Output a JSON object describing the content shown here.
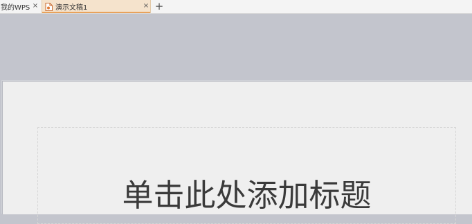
{
  "tabs": {
    "home_label": "我的WPS",
    "doc_label": "演示文稿1",
    "close_glyph": "×",
    "new_tab_glyph": "+",
    "active_color": "#f5e3cc",
    "accent_color": "#e8a25b"
  },
  "slide": {
    "title_placeholder": "单击此处添加标题"
  },
  "icons": {
    "doc_icon": "presentation-file-icon"
  }
}
